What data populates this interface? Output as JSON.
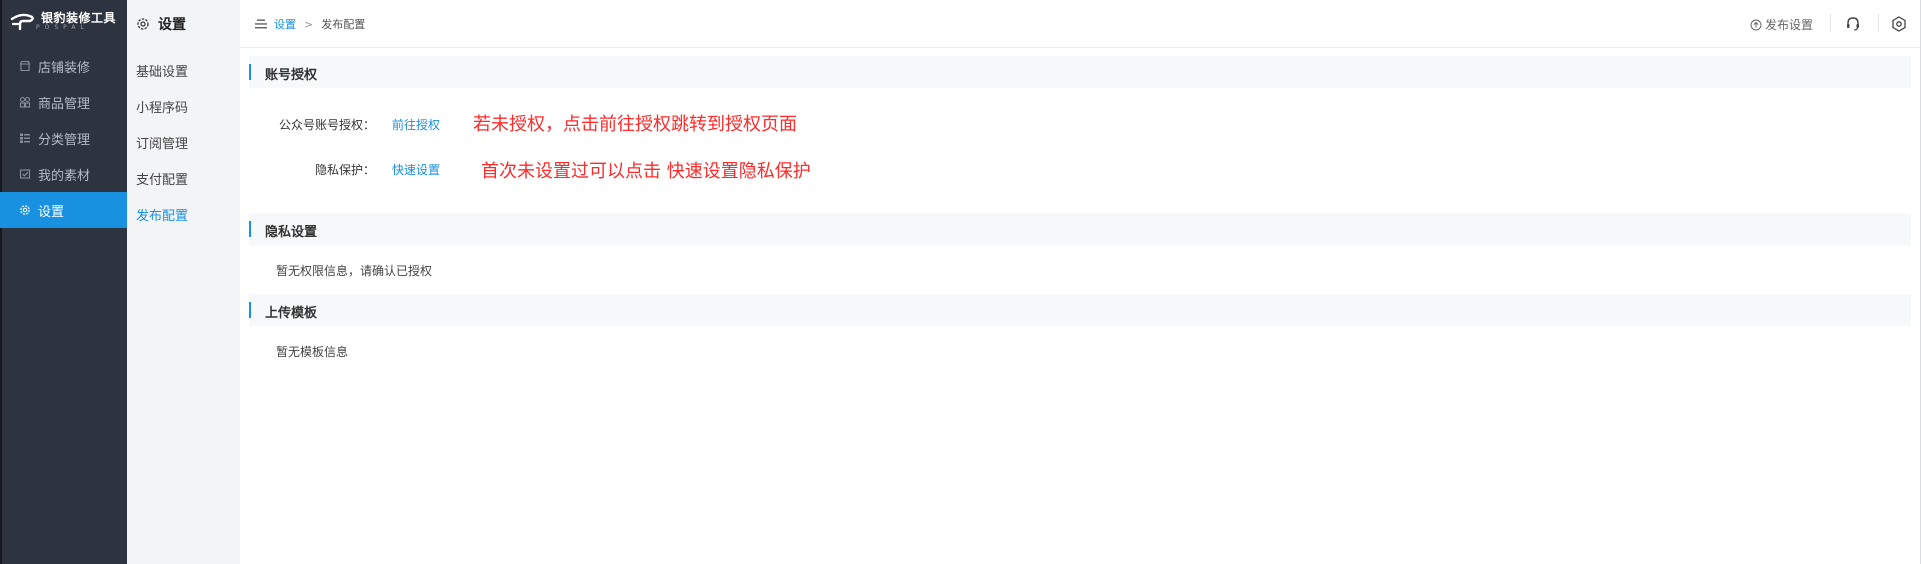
{
  "brand": {
    "name": "银豹装修工具",
    "sub": "POSPAL"
  },
  "nav": [
    {
      "label": "店铺装修",
      "icon": "store-icon"
    },
    {
      "label": "商品管理",
      "icon": "goods-icon"
    },
    {
      "label": "分类管理",
      "icon": "category-icon"
    },
    {
      "label": "我的素材",
      "icon": "material-icon"
    },
    {
      "label": "设置",
      "icon": "gear-icon",
      "active": true
    }
  ],
  "submenu": {
    "title": "设置",
    "items": [
      {
        "label": "基础设置"
      },
      {
        "label": "小程序码"
      },
      {
        "label": "订阅管理"
      },
      {
        "label": "支付配置"
      },
      {
        "label": "发布配置",
        "active": true
      }
    ]
  },
  "breadcrumb": {
    "parent": "设置",
    "separator": ">",
    "current": "发布配置"
  },
  "topbar": {
    "publish_label": "发布设置"
  },
  "sections": {
    "account": {
      "title": "账号授权",
      "row1_label": "公众号账号授权：",
      "row1_link": "前往授权",
      "row1_note": "若未授权，点击前往授权跳转到授权页面",
      "row2_label": "隐私保护：",
      "row2_link": "快速设置",
      "row2_note": "首次未设置过可以点击 快速设置隐私保护"
    },
    "privacy": {
      "title": "隐私设置",
      "empty": "暂无权限信息，请确认已授权"
    },
    "template": {
      "title": "上传模板",
      "empty": "暂无模板信息"
    }
  },
  "colors": {
    "accent": "#1791e0",
    "sidebar": "#2e3340",
    "annotation": "#ff2a2a"
  }
}
